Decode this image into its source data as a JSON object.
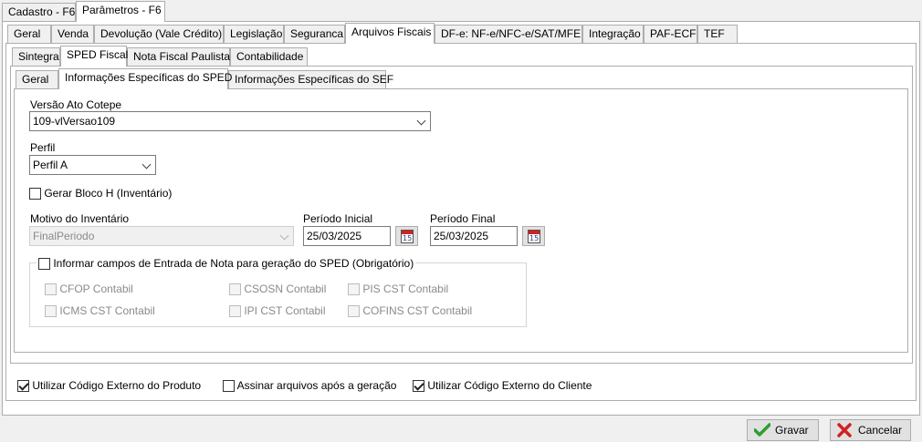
{
  "top_tabs": [
    "Cadastro - F6",
    "Parâmetros - F6"
  ],
  "main_tabs": [
    "Geral",
    "Venda",
    "Devolução (Vale Crédito)",
    "Legislação",
    "Seguranca",
    "Arquivos Fiscais",
    "DF-e: NF-e/NFC-e/SAT/MFE",
    "Integração",
    "PAF-ECF",
    "TEF"
  ],
  "fiscal_tabs": [
    "Sintegra",
    "SPED Fiscal",
    "Nota Fiscal Paulista",
    "Contabilidade"
  ],
  "sped_tabs": [
    "Geral",
    "Informações Específicas do SPED",
    "Informações Específicas do SEF"
  ],
  "form": {
    "versao_label": "Versão Ato Cotepe",
    "versao_value": "109-vlVersao109",
    "perfil_label": "Perfil",
    "perfil_value": "Perfil A",
    "gerar_bloco_h": {
      "label": "Gerar Bloco H (Inventário)",
      "checked": false
    },
    "motivo_label": "Motivo do Inventário",
    "motivo_value": "FinalPeriodo",
    "periodo_inicial_label": "Período Inicial",
    "periodo_inicial_value": "25/03/2025",
    "periodo_final_label": "Período Final",
    "periodo_final_value": "25/03/2025",
    "calendar_icon_day": "15"
  },
  "entrada_group": {
    "label": "Informar campos de Entrada de Nota para geração do SPED (Obrigatório)",
    "checked": false,
    "options": [
      "CFOP Contabil",
      "CSOSN Contabil",
      "PIS CST Contabil",
      "ICMS CST Contabil",
      "IPI CST Contabil",
      "COFINS CST Contabil"
    ]
  },
  "bottom_options": [
    {
      "label": "Utilizar Código Externo do Produto",
      "checked": true
    },
    {
      "label": "Assinar arquivos após a geração",
      "checked": false
    },
    {
      "label": "Utilizar Código Externo do Cliente",
      "checked": true
    }
  ],
  "buttons": {
    "save": "Gravar",
    "cancel": "Cancelar"
  },
  "colors": {
    "save_icon": "#2e9e2e",
    "cancel_icon": "#d32020",
    "calendar_top": "#d32020"
  }
}
